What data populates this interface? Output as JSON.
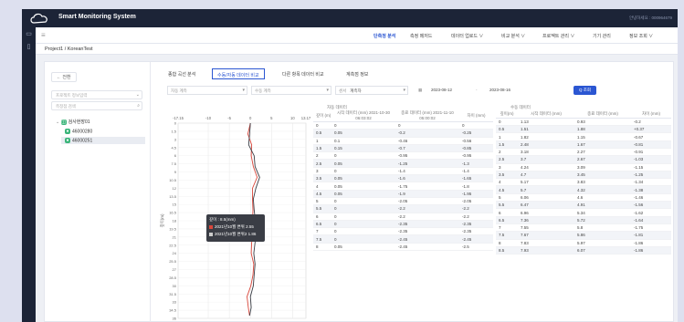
{
  "app": {
    "title": "Smart Monitoring System",
    "user": "안녕하세요 : 000964679"
  },
  "menu": [
    {
      "label": "단측정 분석",
      "active": true
    },
    {
      "label": "측정 메저드",
      "active": false
    },
    {
      "label": "데이터 업로드 ∨",
      "active": false
    },
    {
      "label": "비교 분석 ∨",
      "active": false
    },
    {
      "label": "프로젝트 관리 ∨",
      "active": false
    },
    {
      "label": "기기 관리",
      "active": false
    },
    {
      "label": "정보 조회 ∨",
      "active": false
    }
  ],
  "breadcrumb": "Project1 /  KoreanTest",
  "tree": {
    "back": "← 전환",
    "project_select": "프로젝트 정보입력",
    "search_placeholder": "측정점 검색",
    "root": "검사현장01",
    "nodes": [
      "46000280",
      "46000251"
    ]
  },
  "tabs": [
    {
      "label": "종합 곡선 분석",
      "active": false
    },
    {
      "label": "수동/자동 데이터 비교",
      "active": true
    },
    {
      "label": "다른 항목 데이터 비교",
      "active": false
    },
    {
      "label": "계측점 정보",
      "active": false
    }
  ],
  "filters": {
    "auto": "자동 계측",
    "manual": "수동 계측",
    "sensor": "센서",
    "sensor_value": "계측자",
    "date_from": "2023-08-12",
    "date_sep": "-",
    "date_to": "2023-08-16",
    "search": "Q 조회"
  },
  "chart_data": {
    "type": "line",
    "x_ticks": [
      "-17.15",
      "-10",
      "-5",
      "0",
      "5",
      "10",
      "13.17"
    ],
    "y_ticks": [
      "0",
      "1.5",
      "3",
      "4.5",
      "6",
      "7.5",
      "9",
      "10.5",
      "12",
      "13.5",
      "15",
      "16.5",
      "18",
      "19.5",
      "21",
      "22.5",
      "24",
      "25.5",
      "27",
      "28.5",
      "30",
      "31.5",
      "33",
      "34.5",
      "36"
    ],
    "ylabel": "깊이(m)",
    "xlim": [
      -17.15,
      13.17
    ],
    "ylim": [
      0,
      36
    ],
    "grid": true,
    "series": [
      {
        "name": "2021년10월 변위",
        "color": "#d9463a",
        "values": [
          [
            0,
            0
          ],
          [
            -0.6,
            2
          ],
          [
            0.3,
            4
          ],
          [
            0.2,
            6
          ],
          [
            0.7,
            8
          ],
          [
            1.6,
            10
          ],
          [
            0.5,
            12
          ],
          [
            0.5,
            14
          ],
          [
            0.6,
            16
          ],
          [
            0.5,
            18
          ],
          [
            1.0,
            20
          ],
          [
            0.3,
            22
          ],
          [
            0.2,
            24
          ],
          [
            0.8,
            26
          ],
          [
            0.6,
            28
          ],
          [
            0.1,
            30
          ],
          [
            -0.8,
            32
          ],
          [
            -0.5,
            34
          ],
          [
            -0.2,
            35.5
          ]
        ]
      },
      {
        "name": "2021년10월 변위2",
        "color": "#3a3d45",
        "values": [
          [
            0,
            0
          ],
          [
            -0.2,
            2
          ],
          [
            -0.4,
            4
          ],
          [
            0.9,
            6
          ],
          [
            1.1,
            8
          ],
          [
            2.2,
            10
          ],
          [
            1.3,
            12
          ],
          [
            0.7,
            14
          ],
          [
            0.9,
            16
          ],
          [
            1.2,
            18
          ],
          [
            1.5,
            20
          ],
          [
            1.1,
            22
          ],
          [
            0.8,
            24
          ],
          [
            1.1,
            26
          ],
          [
            0.9,
            28
          ],
          [
            0.7,
            30
          ],
          [
            0.0,
            32
          ],
          [
            0.2,
            34
          ],
          [
            -0.2,
            35.5
          ]
        ]
      }
    ],
    "tooltip": {
      "title": "깊이 : 8.5(mm)",
      "lines": [
        {
          "label": "2021년10월 변위",
          "value": "2.55",
          "color": "#d9463a"
        },
        {
          "label": "2021년10월 변위2",
          "value": "1.86",
          "color": "#cccccc"
        }
      ]
    }
  },
  "table1": {
    "group": "자동 데이터",
    "headers": [
      "깊이 (m)",
      "시작 데이터 (mm) 2021-10-30 06:03:02",
      "종료 데이터 (mm) 2021-11-10 05:00:02",
      "차이 (mm)"
    ],
    "rows": [
      [
        "0",
        "0",
        "0",
        "0"
      ],
      [
        "0.5",
        "0.05",
        "-0.2",
        "-0.25"
      ],
      [
        "1",
        "0.1",
        "-0.46",
        "-0.56"
      ],
      [
        "1.5",
        "0.15",
        "-0.7",
        "-0.85"
      ],
      [
        "2",
        "0",
        "-0.95",
        "-0.95"
      ],
      [
        "2.5",
        "0.05",
        "-1.25",
        "-1.3"
      ],
      [
        "3",
        "0",
        "-1.4",
        "-1.4"
      ],
      [
        "3.5",
        "0.05",
        "-1.6",
        "-1.65"
      ],
      [
        "4",
        "0.05",
        "-1.75",
        "-1.8"
      ],
      [
        "4.5",
        "0.05",
        "-1.9",
        "-1.95"
      ],
      [
        "5",
        "0",
        "-2.05",
        "-2.05"
      ],
      [
        "5.5",
        "0",
        "-2.2",
        "-2.2"
      ],
      [
        "6",
        "0",
        "-2.2",
        "-2.2"
      ],
      [
        "6.5",
        "0",
        "-2.35",
        "-2.35"
      ],
      [
        "7",
        "0",
        "-2.35",
        "-2.35"
      ],
      [
        "7.5",
        "0",
        "-2.45",
        "-2.45"
      ],
      [
        "8",
        "0.05",
        "-2.45",
        "-2.5"
      ]
    ]
  },
  "table2": {
    "group": "수동 데이터",
    "headers": [
      "깊이(m)",
      "시작 데이터 (mm)",
      "종료 데이터 (mm)",
      "차이 (mm)"
    ],
    "rows": [
      [
        "0",
        "1.13",
        "0.93",
        "-0.2"
      ],
      [
        "0.5",
        "1.51",
        "1.88",
        "+0.37"
      ],
      [
        "1",
        "1.82",
        "1.15",
        "-0.67"
      ],
      [
        "1.5",
        "2.48",
        "1.67",
        "-0.81"
      ],
      [
        "2",
        "3.18",
        "2.27",
        "-0.91"
      ],
      [
        "2.5",
        "3.7",
        "2.67",
        "-1.03"
      ],
      [
        "3",
        "4.24",
        "3.09",
        "-1.15"
      ],
      [
        "3.5",
        "4.7",
        "3.45",
        "-1.25"
      ],
      [
        "4",
        "5.17",
        "3.83",
        "-1.34"
      ],
      [
        "4.5",
        "5.7",
        "4.32",
        "-1.38"
      ],
      [
        "5",
        "6.06",
        "4.6",
        "-1.46"
      ],
      [
        "5.5",
        "6.47",
        "4.91",
        "-1.56"
      ],
      [
        "6",
        "6.96",
        "5.34",
        "-1.62"
      ],
      [
        "6.5",
        "7.36",
        "5.72",
        "-1.64"
      ],
      [
        "7",
        "7.55",
        "5.8",
        "-1.75"
      ],
      [
        "7.5",
        "7.67",
        "5.86",
        "-1.81"
      ],
      [
        "8",
        "7.83",
        "5.97",
        "-1.86"
      ],
      [
        "8.5",
        "7.93",
        "6.07",
        "-1.86"
      ]
    ]
  }
}
